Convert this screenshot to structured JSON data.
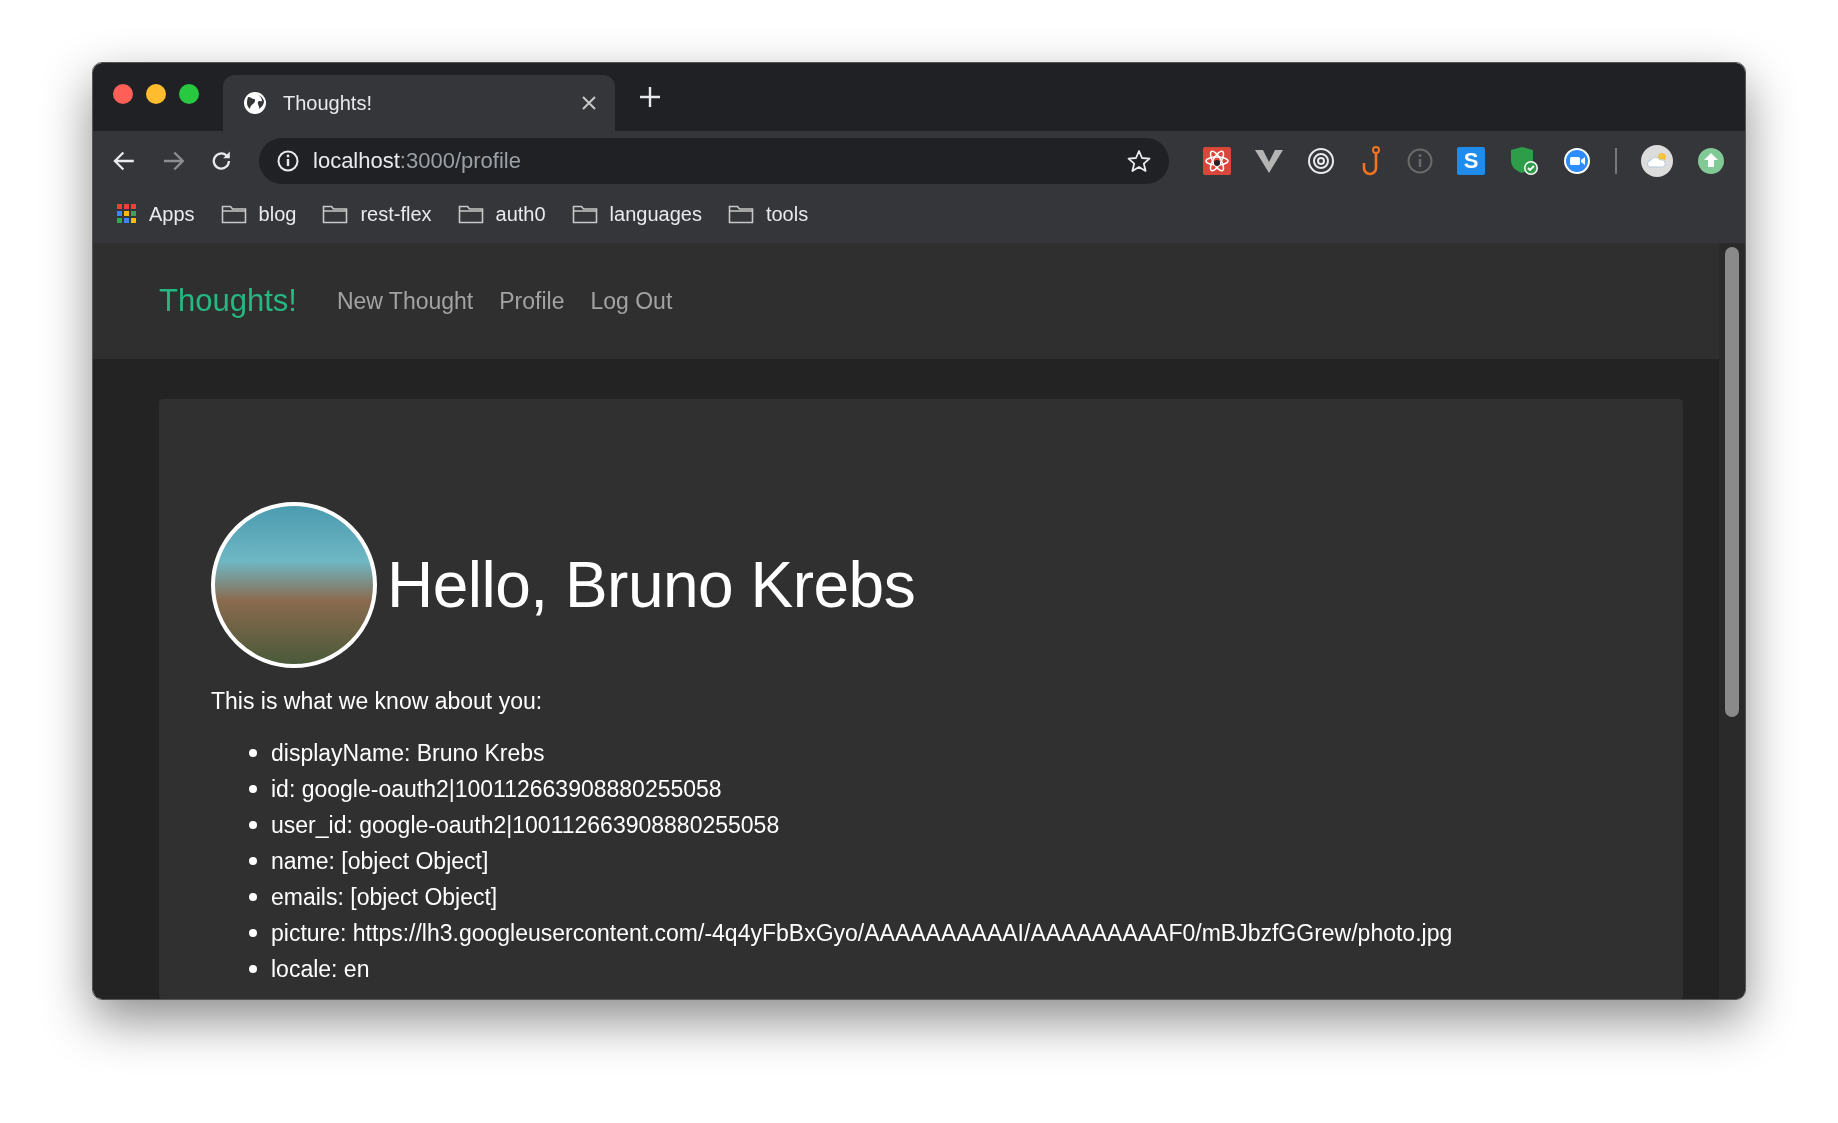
{
  "tab": {
    "title": "Thoughts!"
  },
  "address_bar": {
    "host": "localhost",
    "path": ":3000/profile"
  },
  "extensions": {
    "s_letter": "S"
  },
  "bookmarks": [
    {
      "label": "Apps",
      "kind": "apps"
    },
    {
      "label": "blog",
      "kind": "folder"
    },
    {
      "label": "rest-flex",
      "kind": "folder"
    },
    {
      "label": "auth0",
      "kind": "folder"
    },
    {
      "label": "languages",
      "kind": "folder"
    },
    {
      "label": "tools",
      "kind": "folder"
    }
  ],
  "navbar": {
    "brand": "Thoughts!",
    "links": [
      "New Thought",
      "Profile",
      "Log Out"
    ]
  },
  "profile": {
    "heading": "Hello, Bruno Krebs",
    "intro": "This is what we know about you:",
    "fields": [
      "displayName: Bruno Krebs",
      "id: google-oauth2|100112663908880255058",
      "user_id: google-oauth2|100112663908880255058",
      "name: [object Object]",
      "emails: [object Object]",
      "picture: https://lh3.googleusercontent.com/-4q4yFbBxGyo/AAAAAAAAAAI/AAAAAAAAAF0/mBJbzfGGrew/photo.jpg",
      "locale: en"
    ]
  }
}
